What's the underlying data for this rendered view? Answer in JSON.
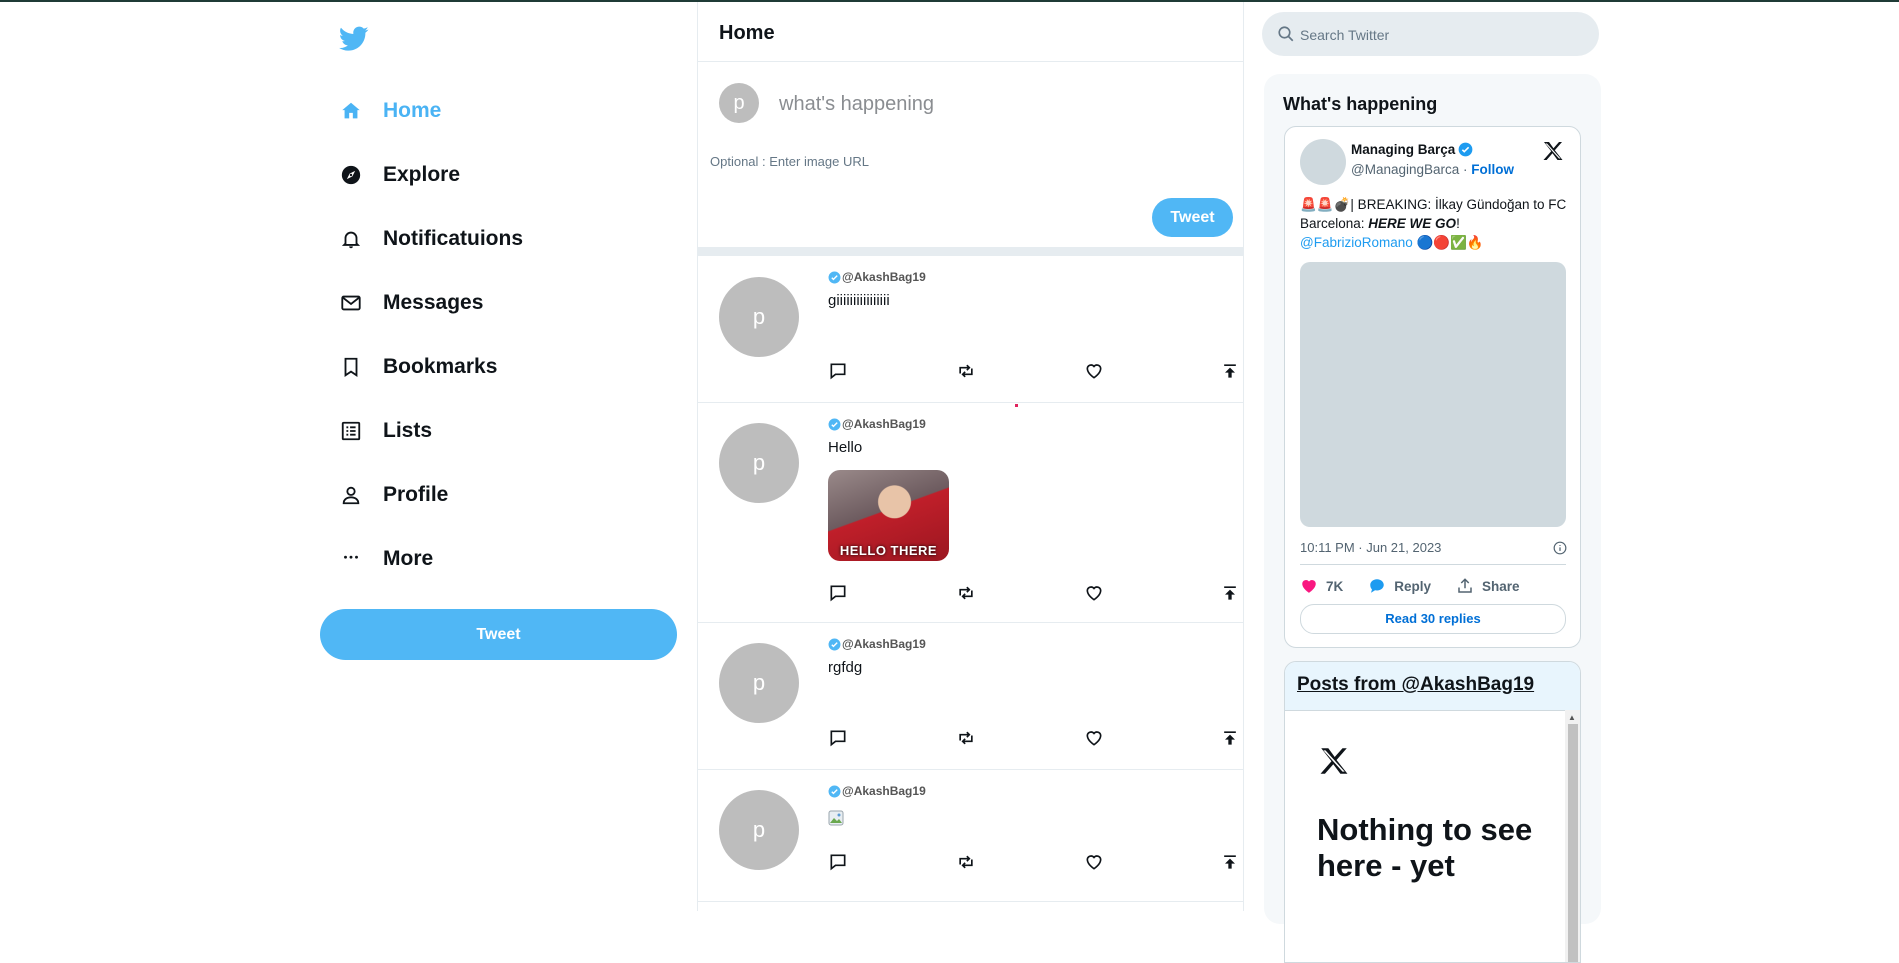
{
  "sidebar": {
    "nav": [
      {
        "label": "Home",
        "icon": "home-icon",
        "active": true
      },
      {
        "label": "Explore",
        "icon": "compass-icon"
      },
      {
        "label": "Notificatuions",
        "icon": "bell-icon"
      },
      {
        "label": "Messages",
        "icon": "mail-icon"
      },
      {
        "label": "Bookmarks",
        "icon": "bookmark-icon"
      },
      {
        "label": "Lists",
        "icon": "list-icon"
      },
      {
        "label": "Profile",
        "icon": "person-icon"
      },
      {
        "label": "More",
        "icon": "more-icon"
      }
    ],
    "tweet_button": "Tweet"
  },
  "feed": {
    "title": "Home",
    "composer": {
      "avatar_letter": "p",
      "placeholder": "what's happening",
      "image_placeholder": "Optional : Enter image URL",
      "button": "Tweet"
    },
    "posts": [
      {
        "avatar_letter": "p",
        "handle": "@AkashBag19",
        "text": "giiiiiiiiiiiiiiii"
      },
      {
        "avatar_letter": "p",
        "handle": "@AkashBag19",
        "text": "Hello",
        "image_caption": "HELLO THERE"
      },
      {
        "avatar_letter": "p",
        "handle": "@AkashBag19",
        "text": "rgfdg"
      },
      {
        "avatar_letter": "p",
        "handle": "@AkashBag19",
        "text": ""
      }
    ]
  },
  "right": {
    "search_placeholder": "Search Twitter",
    "widget_title": "What's happening",
    "embed": {
      "name": "Managing Barça",
      "handle": "@ManagingBarca",
      "follow": "Follow",
      "text_prefix": "🚨🚨💣| BREAKING: İlkay Gündoğan to FC Barcelona: ",
      "text_emphasis": "HERE WE GO",
      "text_suffix": "!",
      "mention": "@FabrizioRomano",
      "mention_emoji": " 🔵🔴✅🔥",
      "time": "10:11 PM · Jun 21, 2023",
      "likes": "7K",
      "reply": "Reply",
      "share": "Share",
      "read_replies": "Read 30 replies"
    },
    "timeline": {
      "link": "Posts from @AkashBag19",
      "empty": "Nothing to see here - yet"
    }
  },
  "colors": {
    "accent": "#50b7f5",
    "nav_active": "#4ab3f4",
    "like": "#f91880"
  }
}
